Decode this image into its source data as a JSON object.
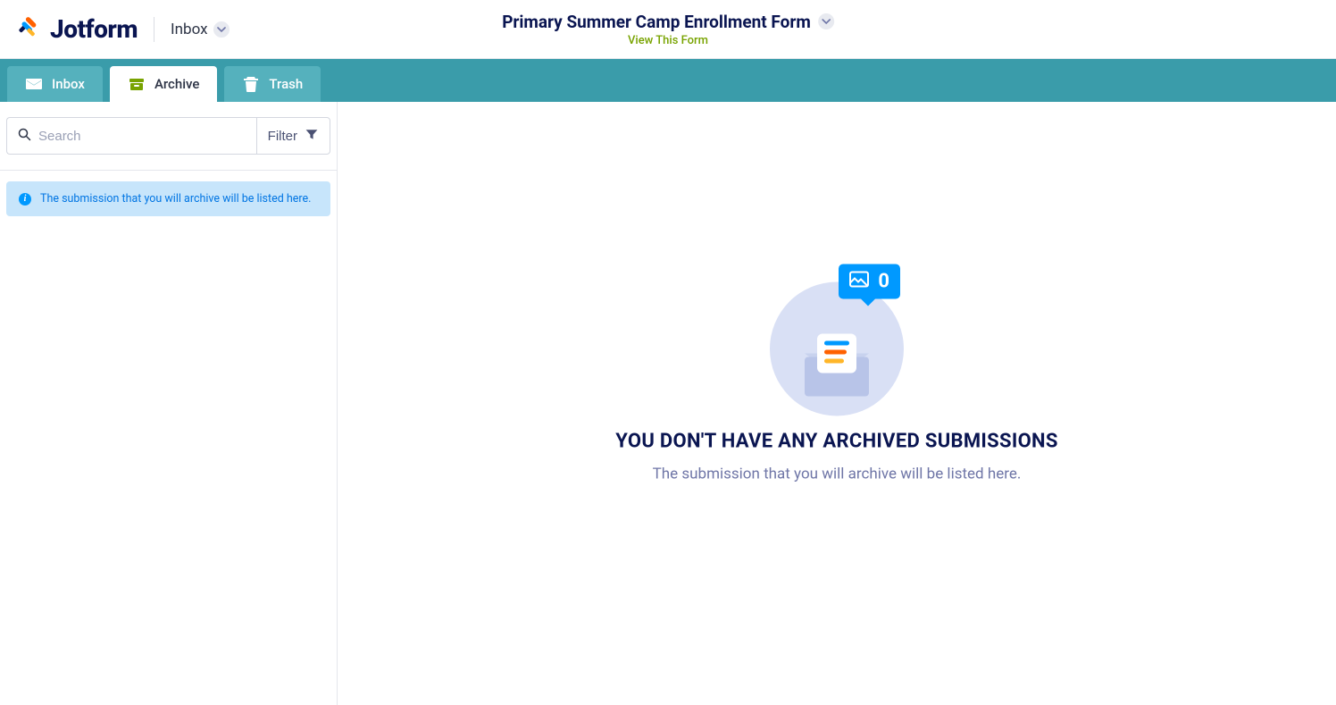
{
  "brand": {
    "name": "Jotform"
  },
  "header": {
    "section_label": "Inbox",
    "form_title": "Primary Summer Camp Enrollment Form",
    "view_form_label": "View This Form"
  },
  "tabs": {
    "inbox": "Inbox",
    "archive": "Archive",
    "trash": "Trash"
  },
  "sidebar": {
    "search_placeholder": "Search",
    "filter_label": "Filter",
    "info_message": "The submission that you will archive will be listed here."
  },
  "empty_state": {
    "badge_count": "0",
    "title": "YOU DON'T HAVE ANY ARCHIVED SUBMISSIONS",
    "subtitle": "The submission that you will archive will be listed here."
  }
}
